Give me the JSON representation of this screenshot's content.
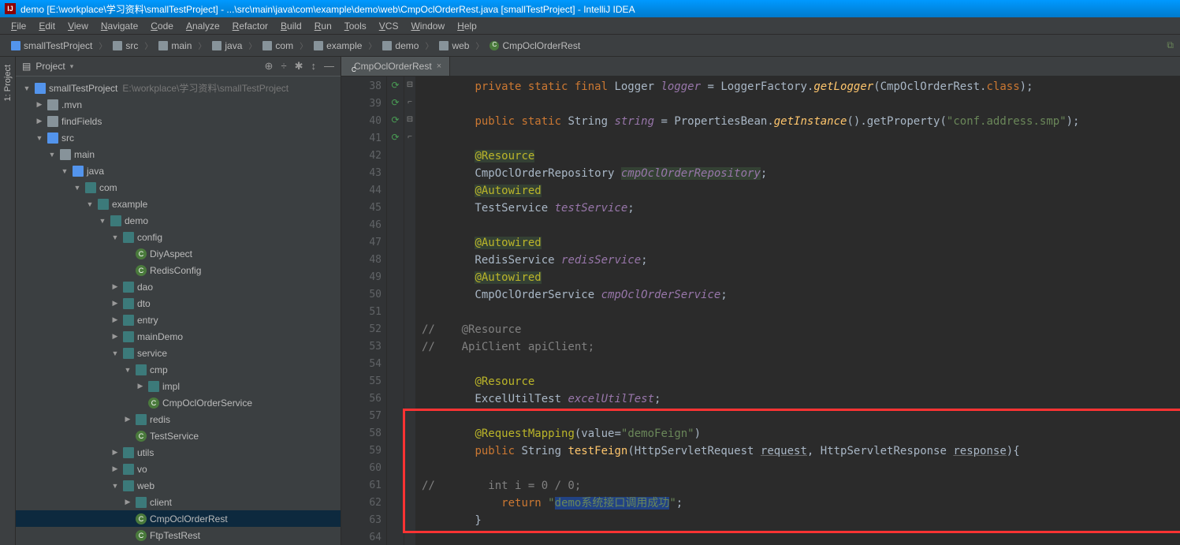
{
  "window_title": "demo [E:\\workplace\\学习资料\\smallTestProject] - ...\\src\\main\\java\\com\\example\\demo\\web\\CmpOclOrderRest.java [smallTestProject] - IntelliJ IDEA",
  "menu": [
    "File",
    "Edit",
    "View",
    "Navigate",
    "Code",
    "Analyze",
    "Refactor",
    "Build",
    "Run",
    "Tools",
    "VCS",
    "Window",
    "Help"
  ],
  "breadcrumbs": [
    "smallTestProject",
    "src",
    "main",
    "java",
    "com",
    "example",
    "demo",
    "web",
    "CmpOclOrderRest"
  ],
  "panel": {
    "title": "Project",
    "tools": [
      "⊕",
      "÷",
      "✱",
      "↕",
      "—"
    ]
  },
  "tree": [
    {
      "d": 0,
      "a": "▼",
      "i": "icon-module",
      "t": "smallTestProject",
      "dim": "E:\\workplace\\学习资料\\smallTestProject"
    },
    {
      "d": 1,
      "a": "▶",
      "i": "icon-folder",
      "t": ".mvn"
    },
    {
      "d": 1,
      "a": "▶",
      "i": "icon-folder",
      "t": "findFields"
    },
    {
      "d": 1,
      "a": "▼",
      "i": "icon-folder-blue",
      "t": "src"
    },
    {
      "d": 2,
      "a": "▼",
      "i": "icon-folder",
      "t": "main"
    },
    {
      "d": 3,
      "a": "▼",
      "i": "icon-folder-blue",
      "t": "java"
    },
    {
      "d": 4,
      "a": "▼",
      "i": "icon-folder-teal",
      "t": "com"
    },
    {
      "d": 5,
      "a": "▼",
      "i": "icon-folder-teal",
      "t": "example"
    },
    {
      "d": 6,
      "a": "▼",
      "i": "icon-folder-teal",
      "t": "demo"
    },
    {
      "d": 7,
      "a": "▼",
      "i": "icon-folder-teal",
      "t": "config"
    },
    {
      "d": 8,
      "a": "",
      "i": "icon-class-c",
      "t": "DiyAspect"
    },
    {
      "d": 8,
      "a": "",
      "i": "icon-class-c",
      "t": "RedisConfig"
    },
    {
      "d": 7,
      "a": "▶",
      "i": "icon-folder-teal",
      "t": "dao"
    },
    {
      "d": 7,
      "a": "▶",
      "i": "icon-folder-teal",
      "t": "dto"
    },
    {
      "d": 7,
      "a": "▶",
      "i": "icon-folder-teal",
      "t": "entry"
    },
    {
      "d": 7,
      "a": "▶",
      "i": "icon-folder-teal",
      "t": "mainDemo"
    },
    {
      "d": 7,
      "a": "▼",
      "i": "icon-folder-teal",
      "t": "service"
    },
    {
      "d": 8,
      "a": "▼",
      "i": "icon-folder-teal",
      "t": "cmp"
    },
    {
      "d": 9,
      "a": "▶",
      "i": "icon-folder-teal",
      "t": "impl"
    },
    {
      "d": 9,
      "a": "",
      "i": "icon-class-c",
      "t": "CmpOclOrderService"
    },
    {
      "d": 8,
      "a": "▶",
      "i": "icon-folder-teal",
      "t": "redis"
    },
    {
      "d": 8,
      "a": "",
      "i": "icon-class-c",
      "t": "TestService"
    },
    {
      "d": 7,
      "a": "▶",
      "i": "icon-folder-teal",
      "t": "utils"
    },
    {
      "d": 7,
      "a": "▶",
      "i": "icon-folder-teal",
      "t": "vo"
    },
    {
      "d": 7,
      "a": "▼",
      "i": "icon-folder-teal",
      "t": "web"
    },
    {
      "d": 8,
      "a": "▶",
      "i": "icon-folder-teal",
      "t": "client"
    },
    {
      "d": 8,
      "a": "",
      "i": "icon-class-c",
      "t": "CmpOclOrderRest",
      "sel": true
    },
    {
      "d": 8,
      "a": "",
      "i": "icon-class-c",
      "t": "FtpTestRest"
    }
  ],
  "editor_tab": "CmpOclOrderRest",
  "gutter_lines": [
    "38",
    "39",
    "40",
    "41",
    "42",
    "43",
    "44",
    "45",
    "46",
    "47",
    "48",
    "49",
    "50",
    "51",
    "52",
    "53",
    "54",
    "55",
    "56",
    "57",
    "58",
    "59",
    "60",
    "61",
    "62",
    "63",
    "64"
  ],
  "gutter_marks": {
    "43": "⟳",
    "45": "⟳",
    "50": "⟳",
    "56": "⟳"
  },
  "code": {
    "l38_logger": "logger",
    "l38_factory": "LoggerFactory",
    "l38_getlogger": "getLogger",
    "l38_class": "CmpOclOrderRest",
    "l40_string": "string",
    "l40_props": "PropertiesBean",
    "l40_getinst": "getInstance",
    "l40_getprop": "getProperty",
    "l40_key": "\"conf.address.smp\"",
    "l42_ann": "@Resource",
    "l43_type": "CmpOclOrderRepository",
    "l43_field": "cmpOclOrderRepository",
    "l44_ann": "@Autowired",
    "l45_type": "TestService",
    "l45_field": "testService",
    "l47_ann": "@Autowired",
    "l48_type": "RedisService",
    "l48_field": "redisService",
    "l49_ann": "@Autowired",
    "l50_type": "CmpOclOrderService",
    "l50_field": "cmpOclOrderService",
    "l52_comment": "//    @Resource",
    "l53_comment": "//    ApiClient apiClient;",
    "l55_ann": "@Resource",
    "l56_type": "ExcelUtilTest",
    "l56_field": "excelUtilTest",
    "l58_ann": "@RequestMapping",
    "l58_val": "\"demoFeign\"",
    "l59_method": "testFeign",
    "l59_req": "request",
    "l59_res": "response",
    "l61_comment": "//        int i = 0 / 0;",
    "l62_return_str": "\"demo系统接口调用成功\""
  },
  "left_tab": "1: Project"
}
